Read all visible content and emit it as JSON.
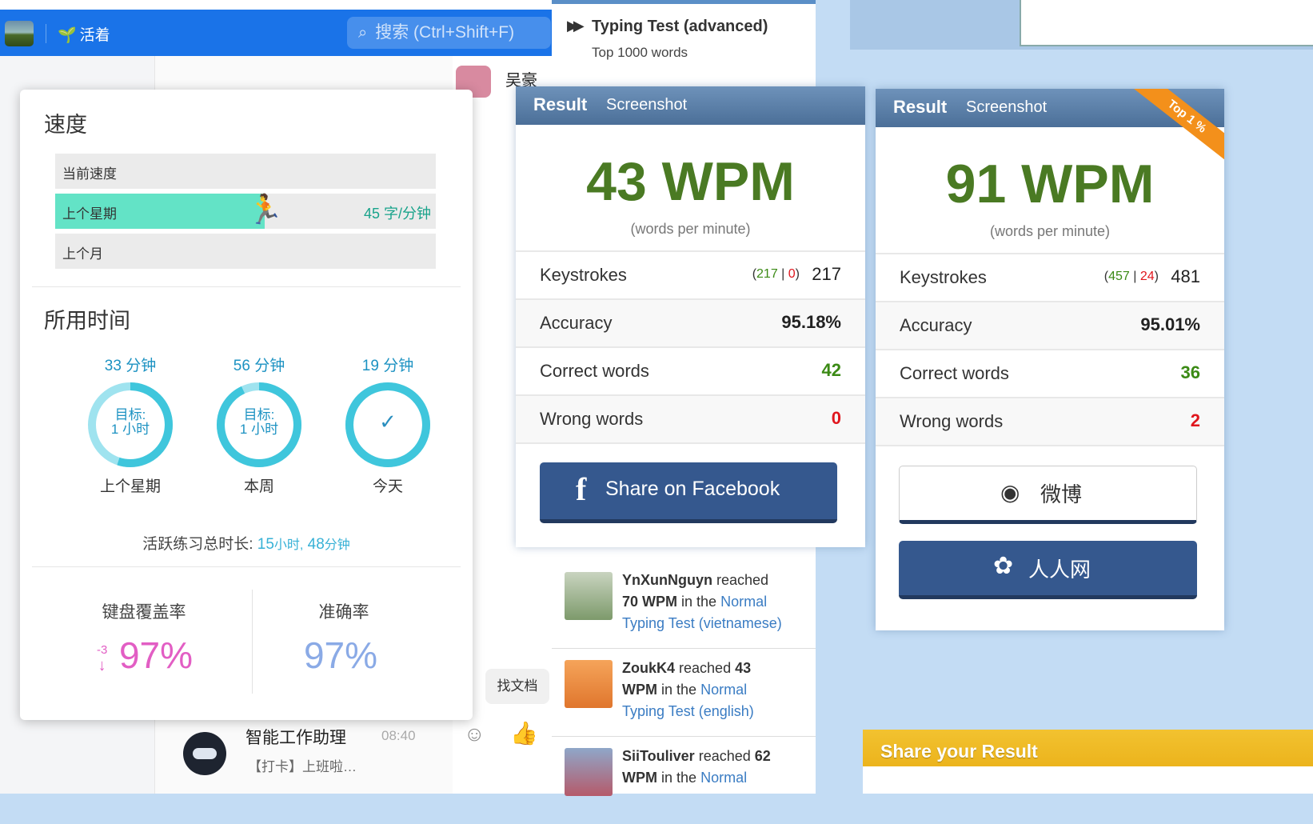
{
  "app": {
    "status_text": "活着",
    "search_placeholder": "搜索 (Ctrl+Shift+F)",
    "top_chat_name": "吴豪",
    "chat_preview": {
      "name": "智能工作助理",
      "time": "08:40",
      "message": "【打卡】上班啦…"
    },
    "find_doc_button": "找文档"
  },
  "speed_panel": {
    "speed_title": "速度",
    "bars": [
      {
        "label": "当前速度",
        "value": ""
      },
      {
        "label": "上个星期",
        "value": "45 字/分钟",
        "fill_fraction": 0.55
      },
      {
        "label": "上个月",
        "value": ""
      }
    ],
    "time_title": "所用时间",
    "rings": [
      {
        "minutes": "33 分钟",
        "center_top": "目标:",
        "center_bottom": "1 小时",
        "label": "上个星期",
        "progress": 0.55
      },
      {
        "minutes": "56 分钟",
        "center_top": "目标:",
        "center_bottom": "1 小时",
        "label": "本周",
        "progress": 0.93
      },
      {
        "minutes": "19 分钟",
        "center_check": "✓",
        "label": "今天",
        "progress": 1.0
      }
    ],
    "total_label": "活跃练习总时长:",
    "total_hours": "15",
    "total_hours_unit": "小时,",
    "total_minutes": "48",
    "total_minutes_unit": "分钟",
    "coverage_label": "键盘覆盖率",
    "coverage_delta": "-3",
    "coverage_value": "97%",
    "accuracy_label": "准确率",
    "accuracy_value": "97%"
  },
  "typing_test": {
    "title": "Typing Test (advanced)",
    "subtitle": "Top 1000 words"
  },
  "results": [
    {
      "tab_result": "Result",
      "tab_screenshot": "Screenshot",
      "wpm": "43 WPM",
      "wpm_sub": "(words per minute)",
      "keystrokes_label": "Keystrokes",
      "ks_correct": "217",
      "ks_wrong": "0",
      "ks_total": "217",
      "accuracy_label": "Accuracy",
      "accuracy": "95.18%",
      "correct_label": "Correct words",
      "correct": "42",
      "wrong_label": "Wrong words",
      "wrong": "0",
      "share_button": "Share on Facebook"
    },
    {
      "tab_result": "Result",
      "tab_screenshot": "Screenshot",
      "ribbon": "Top 1 %",
      "wpm": "91 WPM",
      "wpm_sub": "(words per minute)",
      "keystrokes_label": "Keystrokes",
      "ks_correct": "457",
      "ks_wrong": "24",
      "ks_total": "481",
      "accuracy_label": "Accuracy",
      "accuracy": "95.01%",
      "correct_label": "Correct words",
      "correct": "36",
      "wrong_label": "Wrong words",
      "wrong": "2",
      "weibo_button": "微博",
      "renren_button": "人人网"
    }
  ],
  "feed": [
    {
      "user": "YnXunNguyn",
      "reached": "reached",
      "wpm": "70 WPM",
      "in_the": "in the",
      "mode": "Normal",
      "test": "Typing Test (vietnamese)"
    },
    {
      "user": "ZoukK4",
      "reached": "reached",
      "wpm": "43 WPM",
      "in_the": "in the",
      "mode": "Normal",
      "test": "Typing Test (english)"
    },
    {
      "user": "SiiTouliver",
      "reached": "reached",
      "wpm": "62 WPM",
      "in_the": "in the",
      "mode": "Normal",
      "test": ""
    }
  ],
  "share_result_label": "Share your Result",
  "colors": {
    "accent_blue": "#1a73e8",
    "wpm_green": "#4a7a23",
    "wrong_red": "#e0161d",
    "ring_cyan": "#3fc6dc",
    "coverage_pink": "#e25ec4",
    "accuracy_blue": "#8aaae6"
  }
}
